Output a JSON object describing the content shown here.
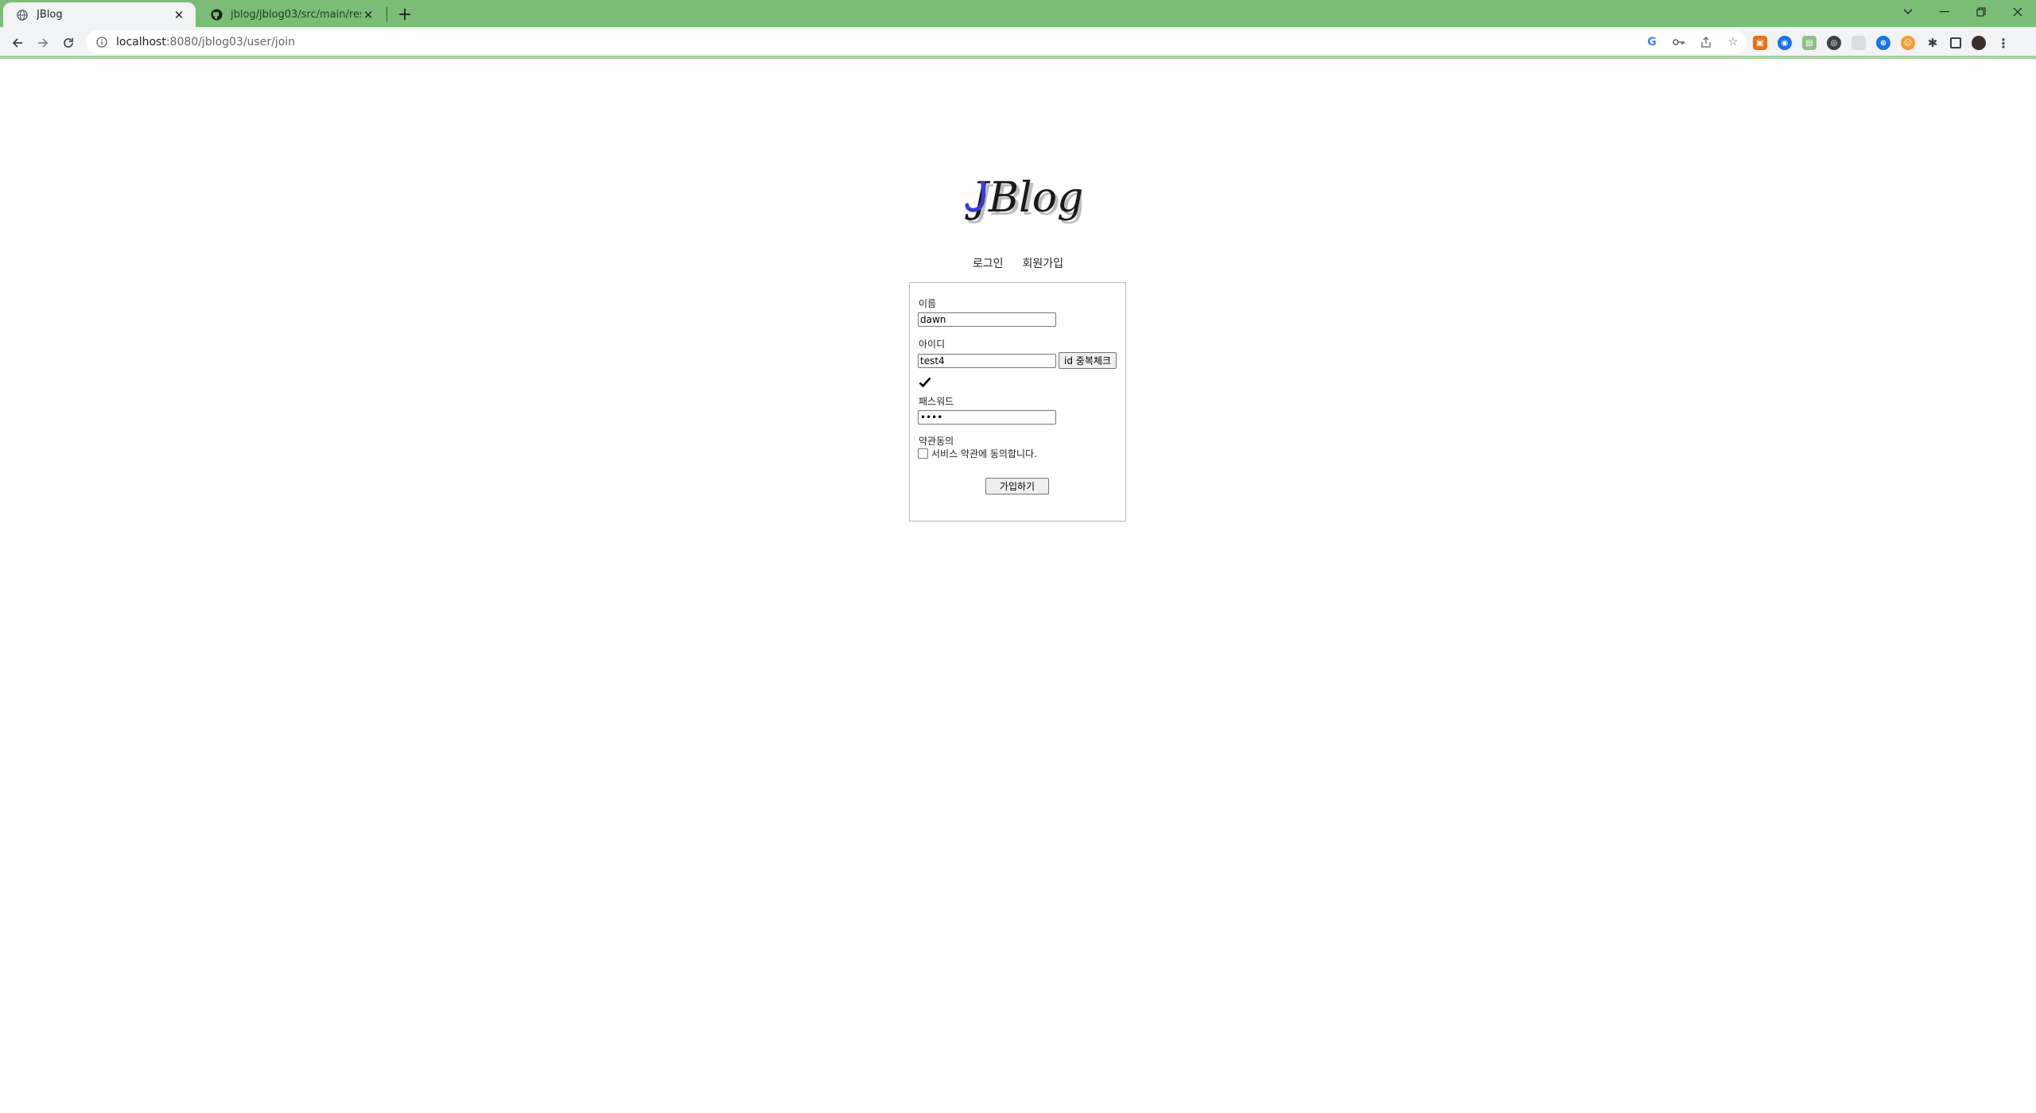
{
  "browser": {
    "tabs": [
      {
        "title": "JBlog",
        "active": true
      },
      {
        "title": "jblog/jblog03/src/main/resourc",
        "active": false
      }
    ],
    "url": {
      "host": "localhost",
      "rest": ":8080/jblog03/user/join"
    },
    "window_controls": [
      "minimize",
      "restore",
      "close"
    ]
  },
  "page": {
    "logo_text": "JBlog",
    "nav": {
      "login": "로그인",
      "join": "회원가입"
    },
    "form": {
      "name_label": "이름",
      "name_value": "dawn",
      "id_label": "아이디",
      "id_value": "test4",
      "id_check_button": "id 중복체크",
      "password_label": "패스워드",
      "password_value": "••••",
      "terms_label": "약관동의",
      "terms_checkbox_label": "서비스 약관에 동의합니다.",
      "terms_checked": false,
      "submit_button": "가입하기"
    }
  },
  "colors": {
    "tabstrip": "#7bbd76",
    "toolbar": "#f1f3f4",
    "logo_j": "#3b3bd6"
  }
}
